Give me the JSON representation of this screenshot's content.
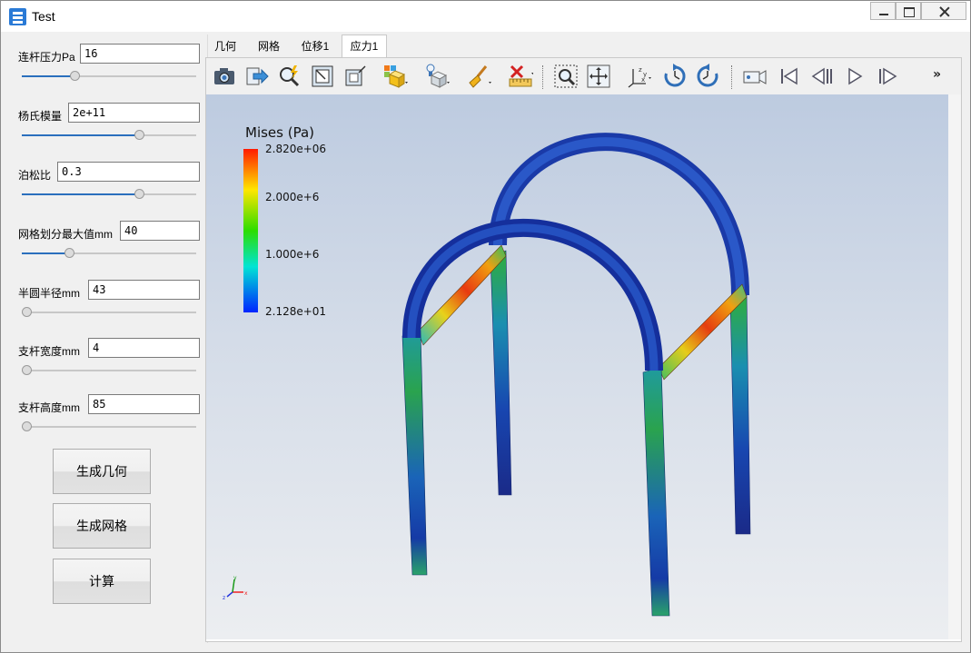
{
  "window": {
    "title": "Test"
  },
  "params": [
    {
      "label": "连杆压力Pa",
      "value": "16",
      "slider": 0.3
    },
    {
      "label": "杨氏模量",
      "value": "2e+11",
      "slider": 0.67
    },
    {
      "label": "泊松比",
      "value": "0.3",
      "slider": 0.67
    },
    {
      "label": "网格划分最大值mm",
      "value": "40",
      "slider": 0.27
    },
    {
      "label": "半圆半径mm",
      "value": "43",
      "slider": 0.0
    },
    {
      "label": "支杆宽度mm",
      "value": "4",
      "slider": 0.0
    },
    {
      "label": "支杆高度mm",
      "value": "85",
      "slider": 0.0
    }
  ],
  "buttons": {
    "geometry": "生成几何",
    "mesh": "生成网格",
    "compute": "计算"
  },
  "tabs": [
    "几何",
    "网格",
    "位移1",
    "应力1"
  ],
  "active_tab": "应力1",
  "toolbar": {
    "icons": [
      "camera-icon",
      "export-icon",
      "interact-icon",
      "zoom-box-icon",
      "zoom-fit-icon",
      "color-map-icon",
      "display-mode-icon",
      "clean-icon",
      "ruler-icon",
      "zoom-region-icon",
      "pan-icon",
      "axes-icon",
      "rotate-cw-icon",
      "rotate-ccw-icon",
      "record-icon",
      "first-frame-icon",
      "prev-frame-icon",
      "play-icon",
      "last-frame-icon"
    ],
    "more": "»"
  },
  "legend": {
    "title": "Mises (Pa)",
    "ticks": [
      "2.820e+06",
      "2.000e+6",
      "1.000e+6",
      "2.128e+01"
    ],
    "colormap": [
      "#ff1a00",
      "#ffe600",
      "#2ddd00",
      "#00e4d4",
      "#0024ff"
    ]
  },
  "axes": {
    "x": "x",
    "y": "y",
    "z": "z"
  }
}
